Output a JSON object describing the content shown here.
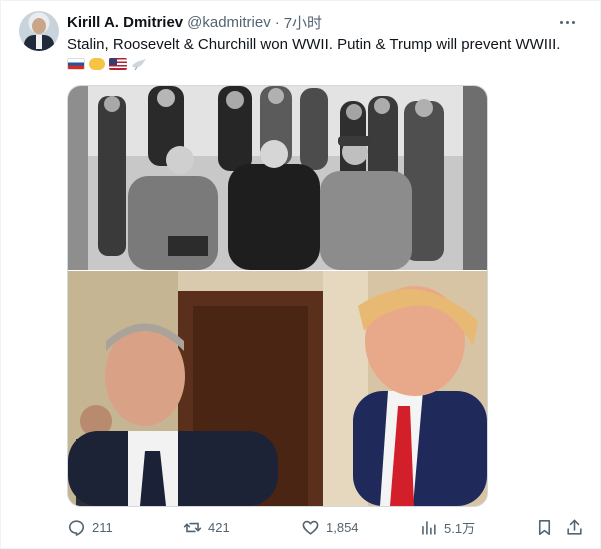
{
  "author": {
    "name": "Kirill A. Dmitriev",
    "handle": "@kadmitriev",
    "separator": "·",
    "time": "7小时"
  },
  "tweet": {
    "text": "Stalin, Roosevelt & Churchill won WWII. Putin & Trump will prevent WWIII.",
    "emojis": [
      "russia-flag",
      "handshake",
      "usa-flag",
      "dove"
    ]
  },
  "media": {
    "top_image": "photo",
    "bottom_image": "photo"
  },
  "actions": {
    "replies": "211",
    "reposts": "421",
    "likes": "1,854",
    "views": "5.1万"
  },
  "colors": {
    "text": "#0f1419",
    "secondary": "#536471",
    "border": "#cfd9de"
  }
}
